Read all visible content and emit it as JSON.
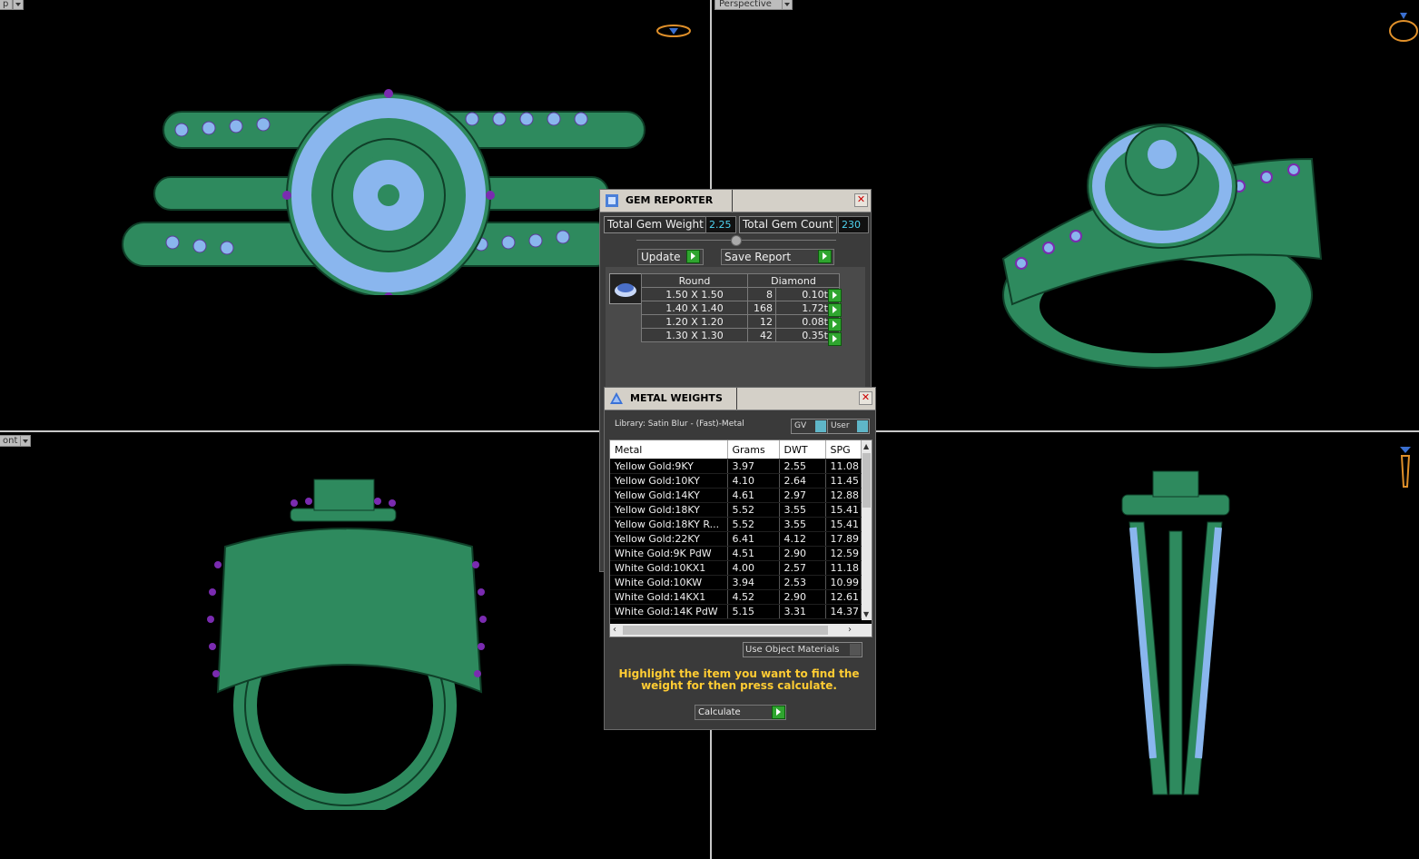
{
  "viewports": {
    "top_left": {
      "tab": "p"
    },
    "top_right": {
      "tab": "Perspective"
    },
    "bottom_left": {
      "tab": "ont"
    }
  },
  "colors": {
    "metal": "#2e8a5e",
    "gem": "#8ab6ee",
    "prong": "#7a2bb0"
  },
  "gem_reporter": {
    "title": "GEM REPORTER",
    "total_weight_label": "Total Gem Weight",
    "total_weight_value": "2.25",
    "total_count_label": "Total Gem Count",
    "total_count_value": "230",
    "update_label": "Update",
    "save_label": "Save Report",
    "shape_header": "Round",
    "type_header": "Diamond",
    "rows": [
      {
        "size": "1.50 X 1.50",
        "count": "8",
        "weight": "0.10tw"
      },
      {
        "size": "1.40 X 1.40",
        "count": "168",
        "weight": "1.72tw"
      },
      {
        "size": "1.20 X 1.20",
        "count": "12",
        "weight": "0.08tw"
      },
      {
        "size": "1.30 X 1.30",
        "count": "42",
        "weight": "0.35tw"
      }
    ]
  },
  "metal_weights": {
    "title": "METAL WEIGHTS",
    "library": "Library: Satin Blur - (Fast)-Metal",
    "gv_label": "GV",
    "user_label": "User",
    "headers": [
      "Metal",
      "Grams",
      "DWT",
      "SPG"
    ],
    "rows": [
      [
        "Yellow Gold:9KY",
        "3.97",
        "2.55",
        "11.08"
      ],
      [
        "Yellow Gold:10KY",
        "4.10",
        "2.64",
        "11.45"
      ],
      [
        "Yellow Gold:14KY",
        "4.61",
        "2.97",
        "12.88"
      ],
      [
        "Yellow Gold:18KY",
        "5.52",
        "3.55",
        "15.41"
      ],
      [
        "Yellow Gold:18KY R...",
        "5.52",
        "3.55",
        "15.41"
      ],
      [
        "Yellow Gold:22KY",
        "6.41",
        "4.12",
        "17.89"
      ],
      [
        "White Gold:9K PdW",
        "4.51",
        "2.90",
        "12.59"
      ],
      [
        "White Gold:10KX1",
        "4.00",
        "2.57",
        "11.18"
      ],
      [
        "White Gold:10KW",
        "3.94",
        "2.53",
        "10.99"
      ],
      [
        "White Gold:14KX1",
        "4.52",
        "2.90",
        "12.61"
      ],
      [
        "White Gold:14K PdW",
        "5.15",
        "3.31",
        "14.37"
      ]
    ],
    "use_object_materials": "Use Object Materials",
    "message": "Highlight the item you want to find the weight for then press calculate.",
    "calculate_label": "Calculate"
  }
}
